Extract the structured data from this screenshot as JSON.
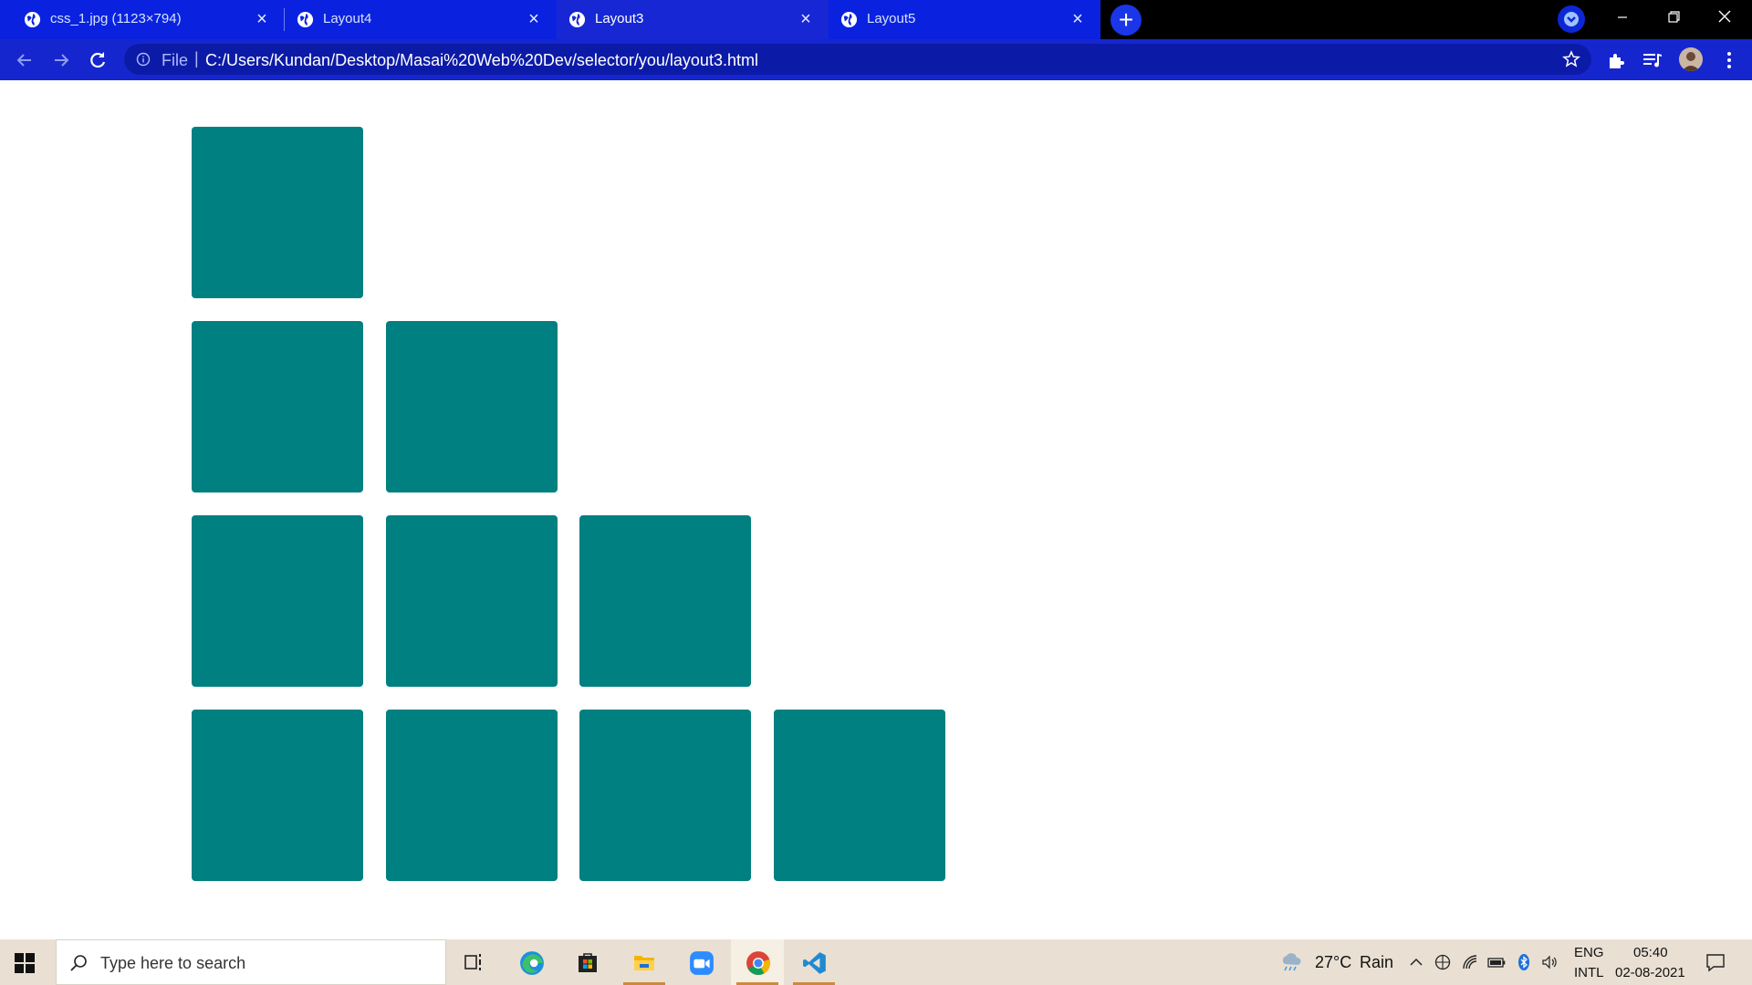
{
  "tabs": [
    {
      "title": "css_1.jpg (1123×794)",
      "icon": "globe-icon",
      "active": false
    },
    {
      "title": "Layout4",
      "icon": "globe-icon",
      "active": false
    },
    {
      "title": "Layout3",
      "icon": "globe-icon",
      "active": true
    },
    {
      "title": "Layout5",
      "icon": "globe-icon",
      "active": false
    }
  ],
  "tab_close_glyph": "×",
  "new_tab_glyph": "+",
  "address_bar": {
    "scheme_label": "File",
    "divider": "|",
    "url": "C:/Users/Kundan/Desktop/Masai%20Web%20Dev/selector/you/layout3.html"
  },
  "layout": {
    "box_color": "#008080",
    "row_counts": [
      1,
      2,
      3,
      4
    ]
  },
  "taskbar": {
    "search_placeholder": "Type here to search",
    "apps": [
      "task-view",
      "edge",
      "store",
      "file-explorer",
      "zoom",
      "chrome",
      "vs-code"
    ],
    "weather_temp": "27°C",
    "weather_desc": "Rain",
    "language_top": "ENG",
    "language_bottom": "INTL",
    "time": "05:40",
    "date": "02-08-2021"
  },
  "colors": {
    "tab_strip": "#000000",
    "tab_active": "#1727d4",
    "toolbar": "#1626cf",
    "omnibox": "#0c1ba7",
    "taskbar": "#e9e0d3"
  }
}
